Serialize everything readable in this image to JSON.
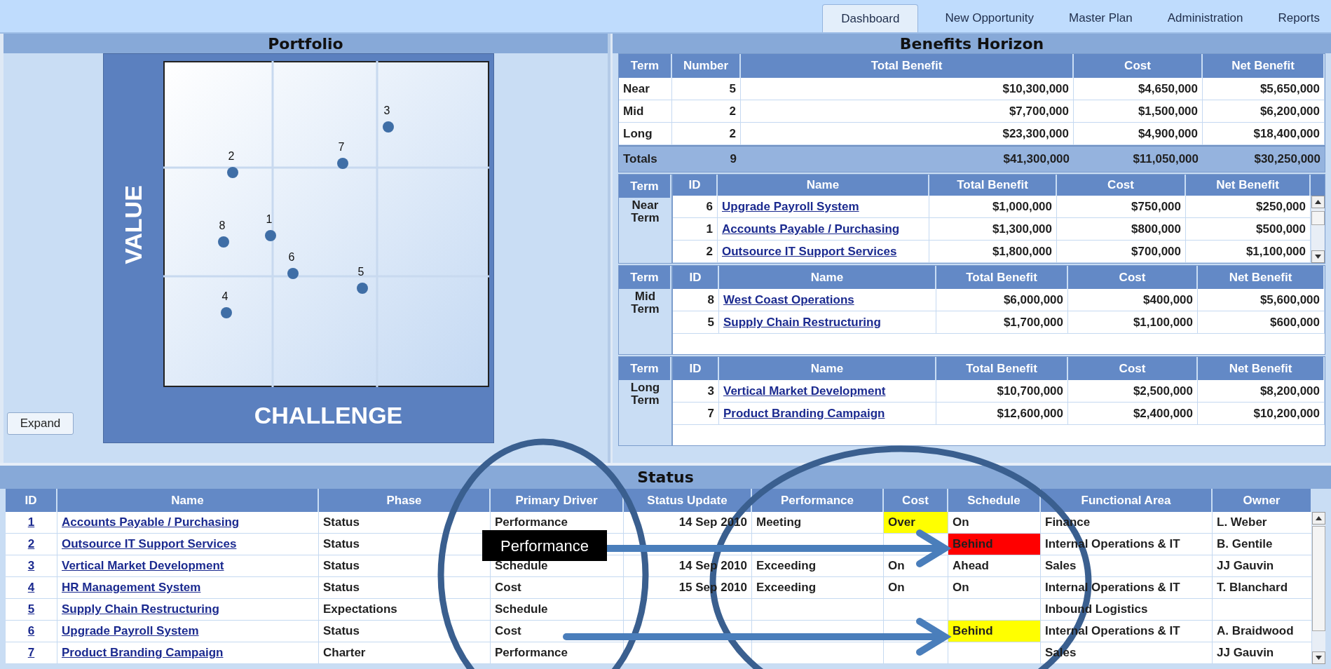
{
  "tabs": [
    {
      "label": "Dashboard",
      "selected": true
    },
    {
      "label": "New Opportunity",
      "selected": false
    },
    {
      "label": "Master Plan",
      "selected": false
    },
    {
      "label": "Administration",
      "selected": false
    },
    {
      "label": "Reports",
      "selected": false
    }
  ],
  "portfolio": {
    "title": "Portfolio",
    "y_axis_label": "VALUE",
    "x_axis_label": "CHALLENGE",
    "expand_button": "Expand",
    "points": [
      {
        "label": "3"
      },
      {
        "label": "7"
      },
      {
        "label": "2"
      },
      {
        "label": "8"
      },
      {
        "label": "1"
      },
      {
        "label": "6"
      },
      {
        "label": "5"
      },
      {
        "label": "4"
      }
    ]
  },
  "benefits_horizon": {
    "title": "Benefits Horizon",
    "summary": {
      "columns": [
        "Term",
        "Number",
        "Total Benefit",
        "Cost",
        "Net Benefit"
      ],
      "rows": [
        [
          "Near",
          "5",
          "$10,300,000",
          "$4,650,000",
          "$5,650,000"
        ],
        [
          "Mid",
          "2",
          "$7,700,000",
          "$1,500,000",
          "$6,200,000"
        ],
        [
          "Long",
          "2",
          "$23,300,000",
          "$4,900,000",
          "$18,400,000"
        ]
      ],
      "totals": [
        "Totals",
        "9",
        "$41,300,000",
        "$11,050,000",
        "$30,250,000"
      ]
    },
    "term_groups": [
      {
        "term": "Near Term",
        "scrollable": true,
        "columns": [
          "Term",
          "ID",
          "Name",
          "Total Benefit",
          "Cost",
          "Net Benefit"
        ],
        "rows": [
          {
            "id": "6",
            "name": "Upgrade Payroll System",
            "total_benefit": "$1,000,000",
            "cost": "$750,000",
            "net_benefit": "$250,000"
          },
          {
            "id": "1",
            "name": "Accounts Payable / Purchasing",
            "total_benefit": "$1,300,000",
            "cost": "$800,000",
            "net_benefit": "$500,000"
          },
          {
            "id": "2",
            "name": "Outsource IT Support Services",
            "total_benefit": "$1,800,000",
            "cost": "$700,000",
            "net_benefit": "$1,100,000"
          }
        ]
      },
      {
        "term": "Mid Term",
        "scrollable": false,
        "columns": [
          "Term",
          "ID",
          "Name",
          "Total Benefit",
          "Cost",
          "Net Benefit"
        ],
        "rows": [
          {
            "id": "8",
            "name": "West Coast Operations",
            "total_benefit": "$6,000,000",
            "cost": "$400,000",
            "net_benefit": "$5,600,000"
          },
          {
            "id": "5",
            "name": "Supply Chain Restructuring",
            "total_benefit": "$1,700,000",
            "cost": "$1,100,000",
            "net_benefit": "$600,000"
          }
        ]
      },
      {
        "term": "Long Term",
        "scrollable": false,
        "columns": [
          "Term",
          "ID",
          "Name",
          "Total Benefit",
          "Cost",
          "Net Benefit"
        ],
        "rows": [
          {
            "id": "3",
            "name": "Vertical Market Development",
            "total_benefit": "$10,700,000",
            "cost": "$2,500,000",
            "net_benefit": "$8,200,000"
          },
          {
            "id": "7",
            "name": "Product Branding Campaign",
            "total_benefit": "$12,600,000",
            "cost": "$2,400,000",
            "net_benefit": "$10,200,000"
          }
        ]
      }
    ]
  },
  "status": {
    "title": "Status",
    "columns": [
      "ID",
      "Name",
      "Phase",
      "Primary Driver",
      "Status Update",
      "Performance",
      "Cost",
      "Schedule",
      "Functional Area",
      "Owner"
    ],
    "rows": [
      {
        "id": "1",
        "name": "Accounts Payable / Purchasing",
        "phase": "Status",
        "primary_driver": "Performance",
        "status_update": "14 Sep 2010",
        "performance": "Meeting",
        "cost": {
          "text": "Over",
          "color": "#ffff00"
        },
        "schedule": {
          "text": "On"
        },
        "functional_area": "Finance",
        "owner": "L. Weber"
      },
      {
        "id": "2",
        "name": "Outsource IT Support Services",
        "phase": "Status",
        "schedule": {
          "text": "Behind",
          "color": "#ff0000"
        },
        "functional_area": "Internal Operations & IT",
        "owner": "B. Gentile"
      },
      {
        "id": "3",
        "name": "Vertical Market Development",
        "phase": "Status",
        "primary_driver": "Schedule",
        "status_update": "14 Sep 2010",
        "performance": "Exceeding",
        "cost": {
          "text": "On"
        },
        "schedule": {
          "text": "Ahead"
        },
        "functional_area": "Sales",
        "owner": "JJ Gauvin"
      },
      {
        "id": "4",
        "name": "HR Management System",
        "phase": "Status",
        "primary_driver": "Cost",
        "status_update": "15 Sep 2010",
        "performance": "Exceeding",
        "cost": {
          "text": "On"
        },
        "schedule": {
          "text": "On"
        },
        "functional_area": "Internal Operations & IT",
        "owner": "T. Blanchard"
      },
      {
        "id": "5",
        "name": "Supply Chain Restructuring",
        "phase": "Expectations",
        "primary_driver": "Schedule",
        "functional_area": "Inbound Logistics"
      },
      {
        "id": "6",
        "name": "Upgrade Payroll System",
        "phase": "Status",
        "primary_driver": "Cost",
        "schedule": {
          "text": "Behind",
          "color": "#ffff00"
        },
        "functional_area": "Internal Operations & IT",
        "owner": "A. Braidwood"
      },
      {
        "id": "7",
        "name": "Product Branding Campaign",
        "phase": "Charter",
        "primary_driver": "Performance",
        "functional_area": "Sales",
        "owner": "JJ Gauvin"
      }
    ]
  },
  "annotation": {
    "label": "Performance"
  }
}
